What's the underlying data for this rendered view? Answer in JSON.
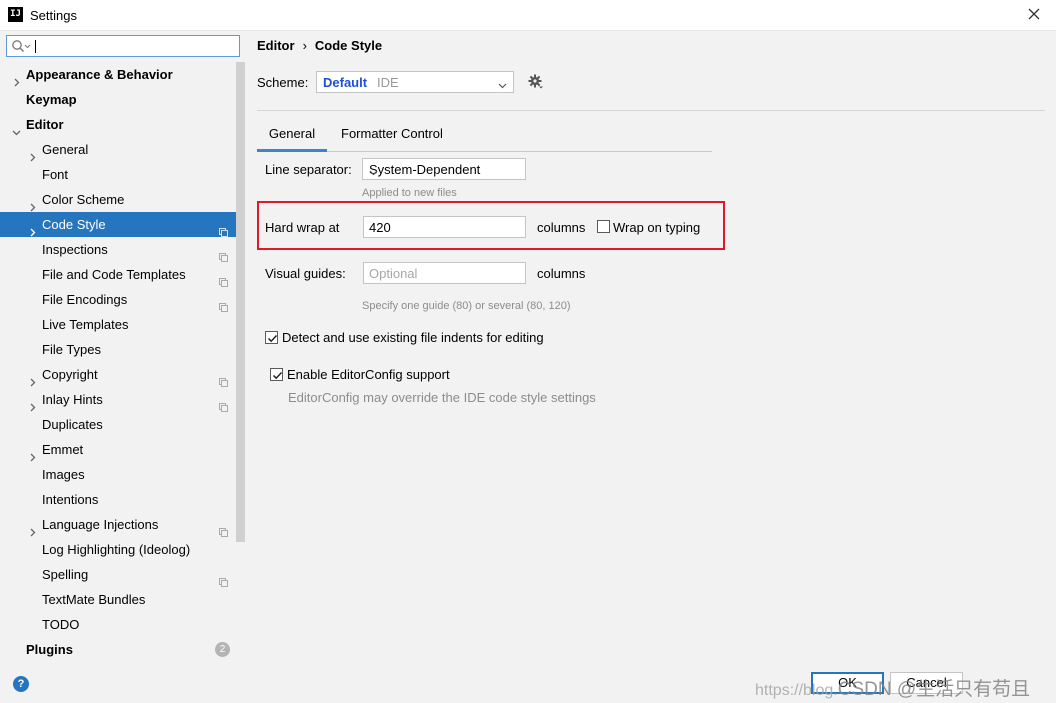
{
  "window": {
    "title": "Settings",
    "app_icon_text": "IJ"
  },
  "search": {
    "value": ""
  },
  "sidebar": {
    "items": [
      {
        "label": "Appearance & Behavior",
        "level": 0,
        "bold": true,
        "arrow": "right"
      },
      {
        "label": "Keymap",
        "level": 0,
        "bold": true,
        "arrow": "none"
      },
      {
        "label": "Editor",
        "level": 0,
        "bold": true,
        "arrow": "down"
      },
      {
        "label": "General",
        "level": 1,
        "arrow": "right"
      },
      {
        "label": "Font",
        "level": 1,
        "arrow": "none"
      },
      {
        "label": "Color Scheme",
        "level": 1,
        "arrow": "right"
      },
      {
        "label": "Code Style",
        "level": 1,
        "arrow": "right",
        "selected": true,
        "project_icon": true
      },
      {
        "label": "Inspections",
        "level": 1,
        "arrow": "none",
        "project_icon": true
      },
      {
        "label": "File and Code Templates",
        "level": 1,
        "arrow": "none",
        "project_icon": true
      },
      {
        "label": "File Encodings",
        "level": 1,
        "arrow": "none",
        "project_icon": true
      },
      {
        "label": "Live Templates",
        "level": 1,
        "arrow": "none"
      },
      {
        "label": "File Types",
        "level": 1,
        "arrow": "none"
      },
      {
        "label": "Copyright",
        "level": 1,
        "arrow": "right",
        "project_icon": true
      },
      {
        "label": "Inlay Hints",
        "level": 1,
        "arrow": "right",
        "project_icon": true
      },
      {
        "label": "Duplicates",
        "level": 1,
        "arrow": "none"
      },
      {
        "label": "Emmet",
        "level": 1,
        "arrow": "right"
      },
      {
        "label": "Images",
        "level": 1,
        "arrow": "none"
      },
      {
        "label": "Intentions",
        "level": 1,
        "arrow": "none"
      },
      {
        "label": "Language Injections",
        "level": 1,
        "arrow": "right",
        "project_icon": true
      },
      {
        "label": "Log Highlighting (Ideolog)",
        "level": 1,
        "arrow": "none"
      },
      {
        "label": "Spelling",
        "level": 1,
        "arrow": "none",
        "project_icon": true
      },
      {
        "label": "TextMate Bundles",
        "level": 1,
        "arrow": "none"
      },
      {
        "label": "TODO",
        "level": 1,
        "arrow": "none"
      },
      {
        "label": "Plugins",
        "level": 0,
        "bold": true,
        "arrow": "none",
        "badge": "2"
      }
    ]
  },
  "breadcrumb": {
    "parent": "Editor",
    "separator": "›",
    "current": "Code Style"
  },
  "scheme": {
    "label": "Scheme:",
    "name": "Default",
    "scope": "IDE"
  },
  "tabs": [
    {
      "label": "General",
      "active": true
    },
    {
      "label": "Formatter Control",
      "active": false
    }
  ],
  "general": {
    "line_separator_label": "Line separator:",
    "line_separator_value": "System-Dependent",
    "line_separator_hint": "Applied to new files",
    "hard_wrap_label": "Hard wrap at",
    "hard_wrap_value": "420",
    "hard_wrap_unit": "columns",
    "wrap_on_typing_label": "Wrap on typing",
    "wrap_on_typing_checked": false,
    "visual_guides_label": "Visual guides:",
    "visual_guides_placeholder": "Optional",
    "visual_guides_unit": "columns",
    "visual_guides_hint": "Specify one guide (80) or several (80, 120)",
    "detect_indents_label": "Detect and use existing file indents for editing",
    "detect_indents_checked": true,
    "editorconfig_label": "Enable EditorConfig support",
    "editorconfig_checked": true,
    "editorconfig_hint": "EditorConfig may override the IDE code style settings"
  },
  "buttons": {
    "help": "?",
    "ok": "OK",
    "cancel": "Cancel"
  },
  "watermark": {
    "url_text": "https://blog.",
    "brand_text": "CSDN @生活只有苟且"
  },
  "colors": {
    "selection": "#2675bf",
    "highlight_box": "#e0192a",
    "scheme_name": "#1f4fd8"
  }
}
